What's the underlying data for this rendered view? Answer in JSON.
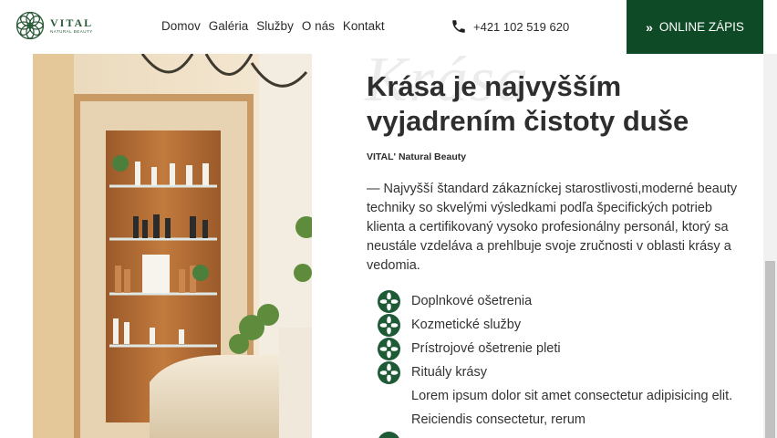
{
  "header": {
    "logo": {
      "name": "VITAL",
      "subtitle": "NATURAL BEAUTY"
    },
    "nav": [
      {
        "label": "Domov"
      },
      {
        "label": "Galéria"
      },
      {
        "label": "Služby"
      },
      {
        "label": "O nás"
      },
      {
        "label": "Kontakt"
      }
    ],
    "phone": "+421 102 519 620",
    "cta": {
      "chevron": "»",
      "label": "ONLINE ZÁPIS"
    }
  },
  "content": {
    "watermark": "Krása",
    "heading": "Krása je najvyšším vyjadrením čistoty duše",
    "brand": "VITAL' Natural Beauty",
    "description": "— Najvyšší štandard zákazníckej starostlivosti,moderné beauty techniky so skvelými výsledkami podľa špecifických potrieb klienta a certifikovaný vysoko profesionálny personál, ktorý sa neustále vzdeláva a prehlbuje svoje zručnosti v oblasti krásy a vedomia.",
    "features": [
      {
        "label": "Doplnkové ošetrenia",
        "icon": "flower-icon"
      },
      {
        "label": "Kozmetické služby",
        "icon": "flower-icon"
      },
      {
        "label": "Prístrojové ošetrenie pleti",
        "icon": "flower-icon"
      },
      {
        "label": "Rituály krásy",
        "icon": "flower-icon"
      }
    ],
    "lorem": "Lorem ipsum dolor sit amet consectetur adipisicing elit. Reiciendis consectetur, rerum"
  },
  "colors": {
    "brand_green": "#0f4a27",
    "text": "#2e2e2e",
    "watermark": "#ececec"
  }
}
